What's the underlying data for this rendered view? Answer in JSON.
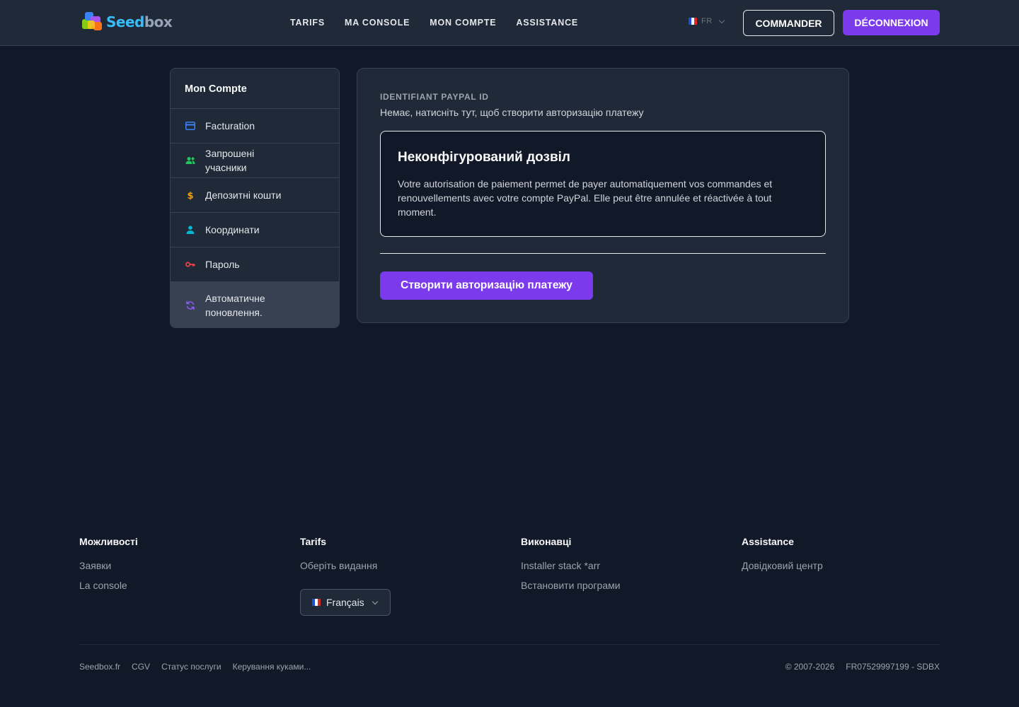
{
  "header": {
    "logo": {
      "text_a": "Seed",
      "text_b": "box"
    },
    "nav": [
      "TARIFS",
      "MA CONSOLE",
      "MON COMPTE",
      "ASSISTANCE"
    ],
    "lang": "FR",
    "order_label": "COMMANDER",
    "logout_label": "DÉCONNEXION"
  },
  "sidebar": {
    "title": "Mon Compte",
    "items": [
      {
        "label": "Facturation",
        "icon": "credit-card-icon",
        "color": "#3b82f6"
      },
      {
        "label": "Запрошені учасники",
        "icon": "users-icon",
        "color": "#22c55e"
      },
      {
        "label": "Депозитні кошти",
        "icon": "dollar-icon",
        "color": "#f59e0b"
      },
      {
        "label": "Координати",
        "icon": "user-icon",
        "color": "#06b6d4"
      },
      {
        "label": "Пароль",
        "icon": "key-icon",
        "color": "#ef4444"
      },
      {
        "label": "Автоматичне поновлення.",
        "icon": "refresh-icon",
        "color": "#8b5cf6",
        "active": true
      }
    ]
  },
  "panel": {
    "field_label": "IDENTIFIANT PAYPAL ID",
    "field_value": "Немає, натисніть тут, щоб створити авторизацію платежу",
    "notice_title": "Неконфігурований дозвіл",
    "notice_text": "Votre autorisation de paiement permet de payer automatiquement vos commandes et renouvellements avec votre compte PayPal. Elle peut être annulée et réactivée à tout moment.",
    "create_button": "Створити авторизацію платежу"
  },
  "footer": {
    "columns": [
      {
        "title": "Можливості",
        "links": [
          "Заявки",
          "La console"
        ]
      },
      {
        "title": "Tarifs",
        "links": [
          "Оберіть видання"
        ]
      },
      {
        "title": "Виконавці",
        "links": [
          "Installer stack *arr",
          "Встановити програми"
        ]
      },
      {
        "title": "Assistance",
        "links": [
          "Довідковий центр"
        ]
      }
    ],
    "language_select": "Français",
    "bottom_links": [
      "Seedbox.fr",
      "CGV",
      "Статус послуги",
      "Керування куками..."
    ],
    "copyright": "© 2007-2026",
    "company_id": "FR07529997199 - SDBX"
  },
  "colors": {
    "accent": "#7c3aed",
    "background": "#111827",
    "surface": "#1f2937"
  }
}
